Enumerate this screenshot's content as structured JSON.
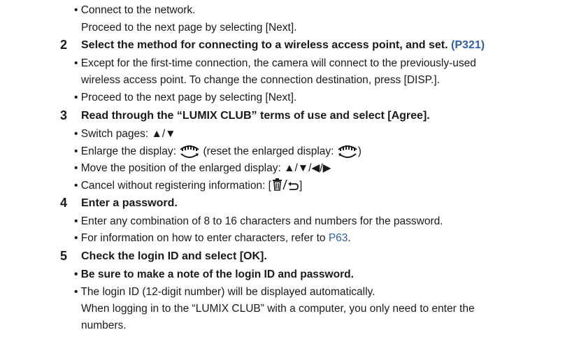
{
  "intro": {
    "bullet_connect": "• Connect to the network.",
    "proceed_next": "Proceed to the next page by selecting [Next]."
  },
  "steps": [
    {
      "number": "2",
      "title": "Select the method for connecting to a wireless access point, and set.",
      "ref": "(P321)",
      "bullets": [
        "• Except for the first-time connection, the camera will connect to the previously-used",
        "wireless access point. To change the connection destination, press [DISP.].",
        "• Proceed to the next page by selecting [Next]."
      ]
    },
    {
      "number": "3",
      "title": "Read through the “LUMIX CLUB” terms of use and select [Agree].",
      "bullets": {
        "switch": "• Switch pages: ▲/▼",
        "enlarge_a": "• Enlarge the display:",
        "enlarge_b": "(reset the enlarged display:",
        "enlarge_c": ")",
        "move": "• Move the position of the enlarged display: ▲/▼/◀/▶",
        "cancel_a": "• Cancel without registering information: [",
        "cancel_b": "]"
      }
    },
    {
      "number": "4",
      "title": "Enter a password.",
      "bullets": [
        "• Enter any combination of 8 to 16 characters and numbers for the password.",
        "• For information on how to enter characters, refer to"
      ],
      "ref": "P63",
      "ref_suffix": "."
    },
    {
      "number": "5",
      "title": "Check the login ID and select [OK].",
      "bullets": [
        "• Be sure to make a note of the login ID and password.",
        "• The login ID (12-digit number) will be displayed automatically.",
        "When logging in to the “LUMIX CLUB” with a computer, you only need to enter the",
        "numbers."
      ]
    }
  ],
  "icons": {
    "rear_dial": "rear-dial-icon",
    "trash_return": "delete-return-icon"
  },
  "colors": {
    "text": "#1a1a1a",
    "link": "#2f5fa8"
  }
}
